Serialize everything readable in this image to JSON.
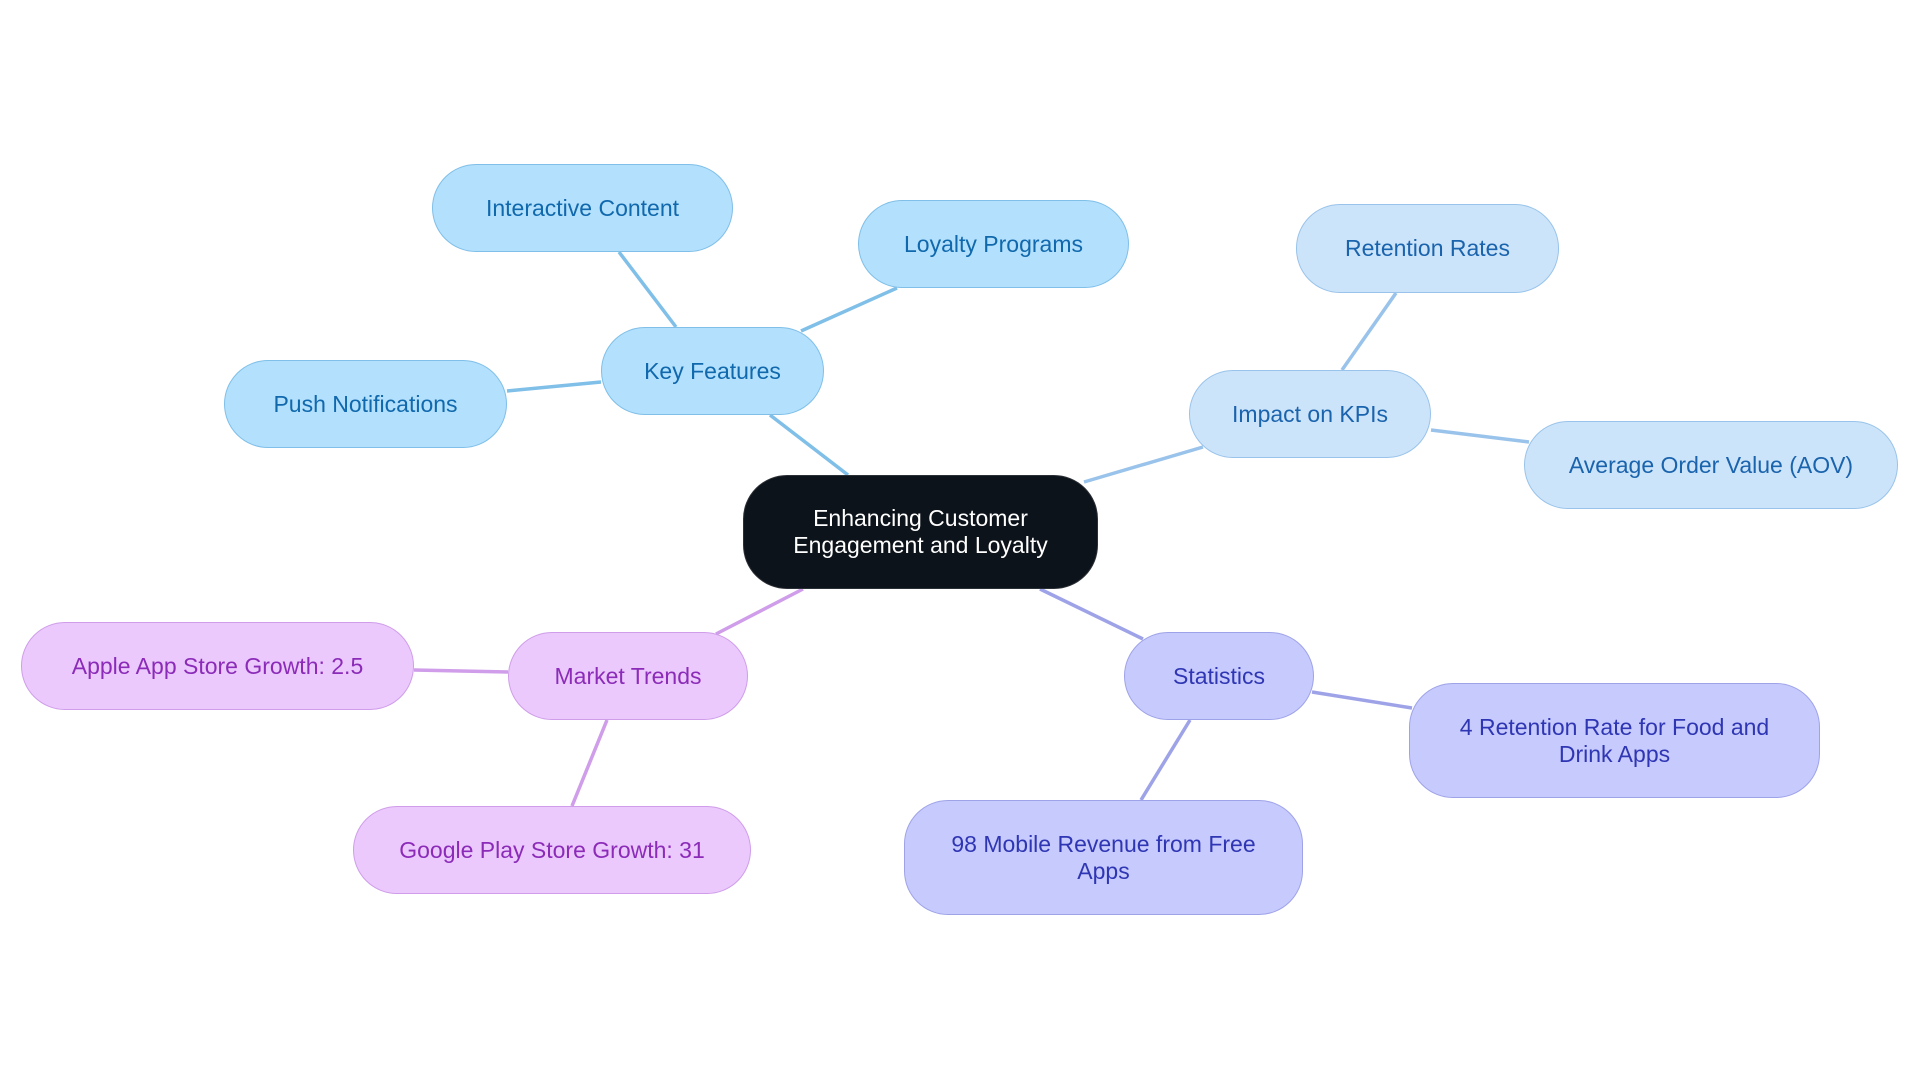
{
  "diagram": {
    "type": "mind-map",
    "root": {
      "id": "root",
      "label": "Enhancing Customer Engagement and Loyalty"
    },
    "colors": {
      "root_fill": "#0d131a",
      "root_text": "#ffffff",
      "blue_fill": "#b3e0fc",
      "blue_edge": "#7fbfe8",
      "blue_text": "#1068ad",
      "lightblue_fill": "#cce4fa",
      "lightblue_edge": "#99c3ea",
      "lightblue_text": "#1a63ad",
      "indigo_fill": "#c7cafd",
      "indigo_edge": "#9ea3e8",
      "indigo_text": "#2f36b3",
      "purple_fill": "#ebc9fd",
      "purple_edge": "#cf9de9",
      "purple_text": "#8b2bb8"
    },
    "branches": [
      {
        "id": "key-features",
        "label": "Key Features",
        "theme": "blue",
        "children": [
          {
            "id": "interactive-content",
            "label": "Interactive Content"
          },
          {
            "id": "loyalty-programs",
            "label": "Loyalty Programs"
          },
          {
            "id": "push-notifications",
            "label": "Push Notifications"
          }
        ]
      },
      {
        "id": "impact-on-kpis",
        "label": "Impact on KPIs",
        "theme": "lightblue",
        "children": [
          {
            "id": "retention-rates",
            "label": "Retention Rates"
          },
          {
            "id": "average-order-value",
            "label": "Average Order Value (AOV)"
          }
        ]
      },
      {
        "id": "statistics",
        "label": "Statistics",
        "theme": "indigo",
        "children": [
          {
            "id": "retention-food-drink",
            "label": "4 Retention Rate for Food and Drink Apps"
          },
          {
            "id": "mobile-revenue-free",
            "label": "98 Mobile Revenue from Free Apps"
          }
        ]
      },
      {
        "id": "market-trends",
        "label": "Market Trends",
        "theme": "purple",
        "children": [
          {
            "id": "apple-growth",
            "label": "Apple App Store Growth: 2.5"
          },
          {
            "id": "google-growth",
            "label": "Google Play Store Growth: 31"
          }
        ]
      }
    ]
  }
}
